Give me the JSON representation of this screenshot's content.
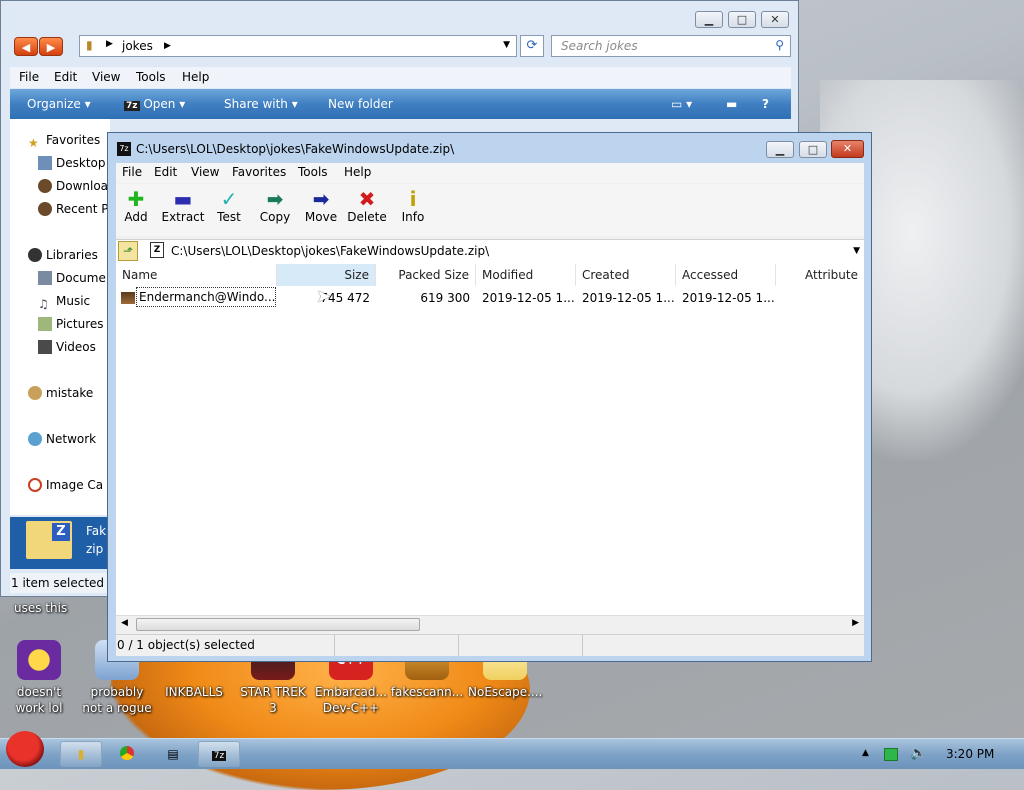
{
  "explorer": {
    "address_folder": "jokes",
    "search_placeholder": "Search jokes",
    "menu": [
      "File",
      "Edit",
      "View",
      "Tools",
      "Help"
    ],
    "commands": [
      "Organize",
      "Open",
      "Share with",
      "New folder"
    ],
    "nav": [
      "Favorites",
      "Desktop",
      "Downloa",
      "Recent P",
      "Libraries",
      "Docume",
      "Music",
      "Pictures",
      "Videos",
      "mistake",
      "Network",
      "Image Ca"
    ],
    "selected_file_name": "Fak",
    "selected_file_ext": "zip",
    "status": "1 item selected"
  },
  "zip": {
    "title": "C:\\Users\\LOL\\Desktop\\jokes\\FakeWindowsUpdate.zip\\",
    "menu": [
      "File",
      "Edit",
      "View",
      "Favorites",
      "Tools",
      "Help"
    ],
    "toolbar": [
      "Add",
      "Extract",
      "Test",
      "Copy",
      "Move",
      "Delete",
      "Info"
    ],
    "path": "C:\\Users\\LOL\\Desktop\\jokes\\FakeWindowsUpdate.zip\\",
    "columns": [
      "Name",
      "Size",
      "Packed Size",
      "Modified",
      "Created",
      "Accessed",
      "Attribute"
    ],
    "rows": [
      {
        "name": "Endermanch@Windo...",
        "size": "745 472",
        "packed": "619 300",
        "modified": "2019-12-05 1...",
        "created": "2019-12-05 1...",
        "accessed": "2019-12-05 1..."
      }
    ],
    "status": "0 / 1 object(s) selected"
  },
  "desktop": {
    "partial_label": "uses this",
    "icons": [
      "doesn't work lol",
      "probably not a rogue",
      "INKBALLS",
      "STAR TREK 3",
      "Embarcad... Dev-C++",
      "fakescann...",
      "NoEscape...."
    ]
  },
  "taskbar": {
    "clock": "3:20 PM",
    "zip_btn": "7z"
  },
  "colors": {
    "accent": "#3f7fc1",
    "selection": "#1f5fa8"
  }
}
